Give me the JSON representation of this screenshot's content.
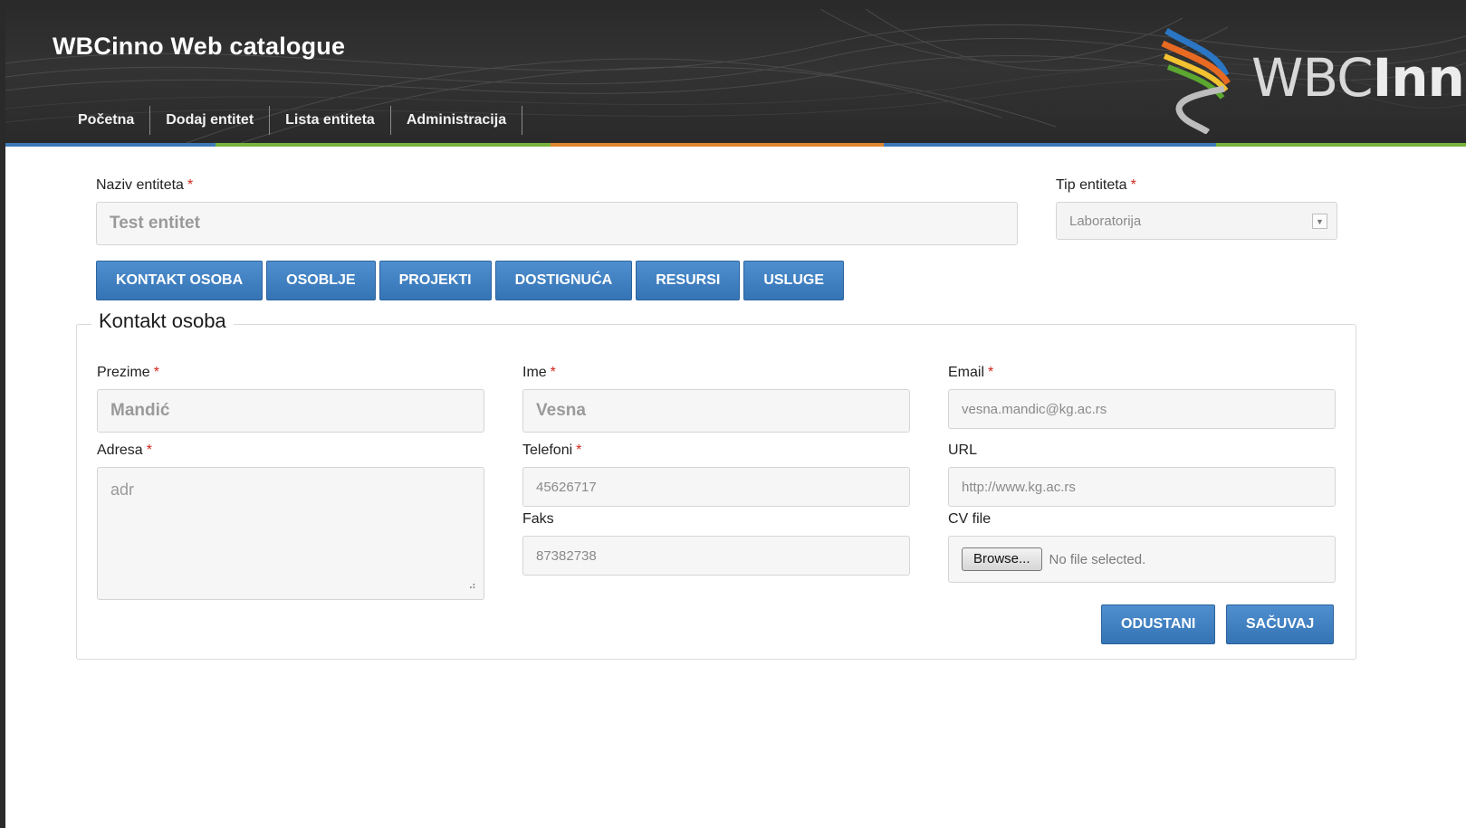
{
  "header": {
    "title": "WBCinno Web catalogue",
    "logo_text_light": "WBC",
    "logo_text_bold": "Inno",
    "nav": [
      {
        "label": "Početna"
      },
      {
        "label": "Dodaj entitet"
      },
      {
        "label": "Lista entiteta"
      },
      {
        "label": "Administracija"
      }
    ],
    "stripe_colors": [
      "#3d79b8",
      "#77b33a",
      "#e0862c",
      "#3d79b8",
      "#77b33a"
    ]
  },
  "entity": {
    "name_label": "Naziv entiteta",
    "name_value": "Test entitet",
    "type_label": "Tip entiteta",
    "type_value": "Laboratorija",
    "required_mark": "*"
  },
  "tabs": [
    {
      "label": "KONTAKT OSOBA"
    },
    {
      "label": "OSOBLJE"
    },
    {
      "label": "PROJEKTI"
    },
    {
      "label": "DOSTIGNUĆA"
    },
    {
      "label": "RESURSI"
    },
    {
      "label": "USLUGE"
    }
  ],
  "contact": {
    "legend": "Kontakt osoba",
    "prezime_label": "Prezime",
    "prezime_value": "Mandić",
    "ime_label": "Ime",
    "ime_value": "Vesna",
    "email_label": "Email",
    "email_value": "vesna.mandic@kg.ac.rs",
    "adresa_label": "Adresa",
    "adresa_value": "adr",
    "telefoni_label": "Telefoni",
    "telefoni_value": "45626717",
    "url_label": "URL",
    "url_value": "http://www.kg.ac.rs",
    "faks_label": "Faks",
    "faks_value": "87382738",
    "cv_label": "CV file",
    "browse_label": "Browse...",
    "no_file_text": "No file selected."
  },
  "actions": {
    "cancel_label": "ODUSTANI",
    "save_label": "SAČUVAJ"
  },
  "colors": {
    "button_blue": "#3b7dbf",
    "required_red": "#d0261b",
    "header_dark": "#2d2d2d"
  }
}
